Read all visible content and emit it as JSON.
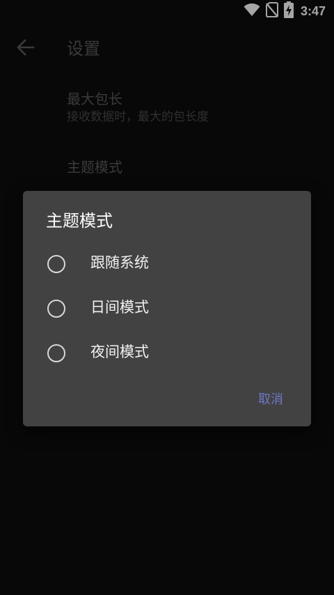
{
  "status_bar": {
    "time": "3:47",
    "icons": [
      "wifi-icon",
      "no-sim-icon",
      "battery-charging-icon"
    ]
  },
  "toolbar": {
    "back_icon": "arrow-left-icon",
    "title": "设置"
  },
  "settings": {
    "max_packet": {
      "title": "最大包长",
      "summary": "接收数据时，最大的包长度"
    },
    "theme_mode": {
      "title": "主题模式"
    }
  },
  "dialog": {
    "title": "主题模式",
    "options": [
      {
        "label": "跟随系统",
        "checked": false
      },
      {
        "label": "日间模式",
        "checked": false
      },
      {
        "label": "夜间模式",
        "checked": false
      }
    ],
    "cancel_label": "取消"
  },
  "colors": {
    "background": "#0d0d0d",
    "dialog": "#424242",
    "accent": "#6e78c8"
  }
}
